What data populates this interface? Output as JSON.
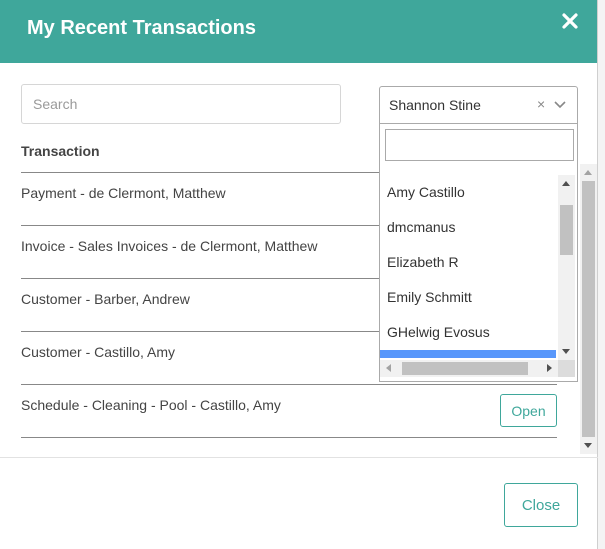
{
  "modal": {
    "title": "My Recent Transactions",
    "close_icon": "close-icon"
  },
  "search": {
    "placeholder": "Search",
    "value": ""
  },
  "table": {
    "column_header": "Transaction",
    "rows": [
      {
        "label": "Payment - de Clermont, Matthew"
      },
      {
        "label": "Invoice - Sales Invoices - de Clermont, Matthew"
      },
      {
        "label": "Customer - Barber, Andrew"
      },
      {
        "label": "Customer - Castillo, Amy"
      },
      {
        "label": "Schedule - Cleaning - Pool - Castillo, Amy",
        "action_label": "Open"
      }
    ]
  },
  "user_select": {
    "selected": "Shannon Stine",
    "clear_symbol": "×",
    "search_value": "",
    "options": [
      "Amy Castillo",
      "dmcmanus",
      "Elizabeth R",
      "Emily Schmitt",
      "GHelwig Evosus"
    ]
  },
  "footer": {
    "close_label": "Close"
  },
  "colors": {
    "accent": "#3fa79b",
    "highlight": "#5897fb"
  }
}
